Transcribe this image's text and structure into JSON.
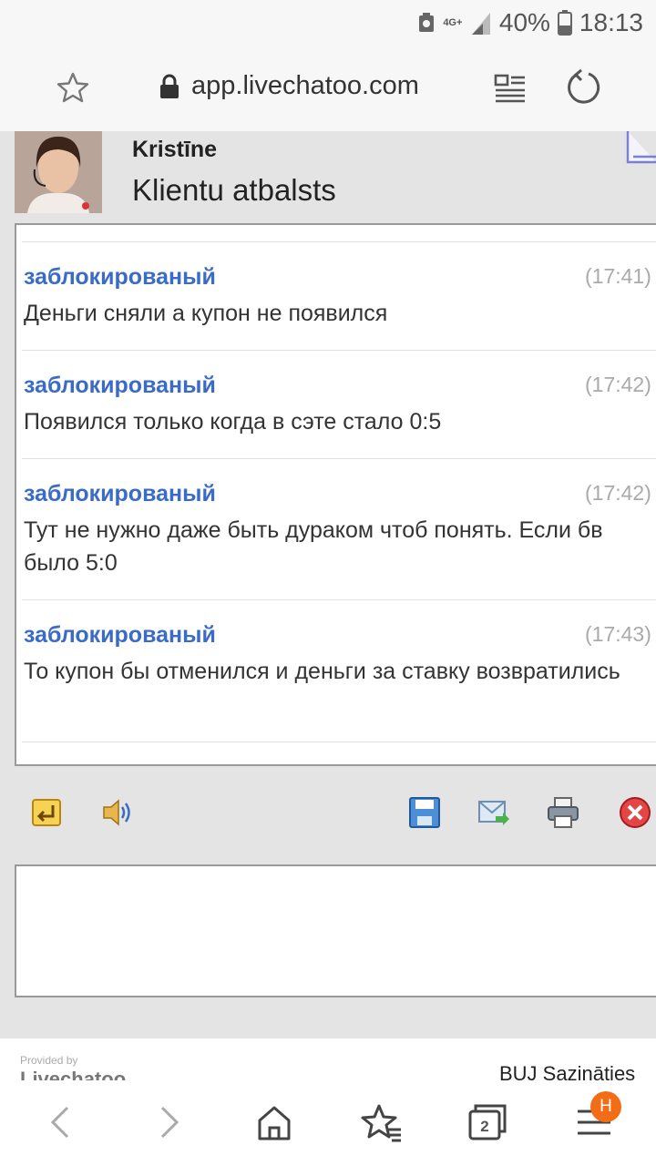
{
  "status_bar": {
    "network_type": "4G+",
    "battery_percent": "40%",
    "battery_level": 0.4,
    "time": "18:13"
  },
  "browser": {
    "url": "app.livechatoo.com",
    "icons": [
      "bookmark-star-icon",
      "lock-icon",
      "reader-mode-icon",
      "reload-icon"
    ]
  },
  "chat_header": {
    "agent_name": "Kristīne",
    "department": "Klientu atbalsts"
  },
  "messages": [
    {
      "author": "заблокированый",
      "time": "(17:41)",
      "text": "Деньги сняли а купон не появился"
    },
    {
      "author": "заблокированый",
      "time": "(17:42)",
      "text": "Появился только когда в сэте стало 0:5"
    },
    {
      "author": "заблокированый",
      "time": "(17:42)",
      "text": "Тут не нужно даже быть дураком чтоб понять. Если бв было 5:0"
    },
    {
      "author": "заблокированый",
      "time": "(17:43)",
      "text": "То купон бы отменился и деньги за ставку возвратились"
    }
  ],
  "toolbar": {
    "icons": [
      "return-icon",
      "sound-icon",
      "save-icon",
      "email-icon",
      "print-icon",
      "close-icon"
    ]
  },
  "footer": {
    "provided_by": "Provided by",
    "brand": "Livechatoo",
    "bu_text": "BUJ  Sazināties"
  },
  "bottom_nav": {
    "tab_count": "2",
    "profile_badge": "H",
    "icons": [
      "back-icon",
      "forward-icon",
      "home-icon",
      "bookmarks-icon",
      "tabs-icon",
      "menu-icon"
    ]
  },
  "colors": {
    "author": "#3a6bc9",
    "time": "#aaaaaa",
    "badge": "#f26d16",
    "page_bg": "#e4e4e4"
  }
}
